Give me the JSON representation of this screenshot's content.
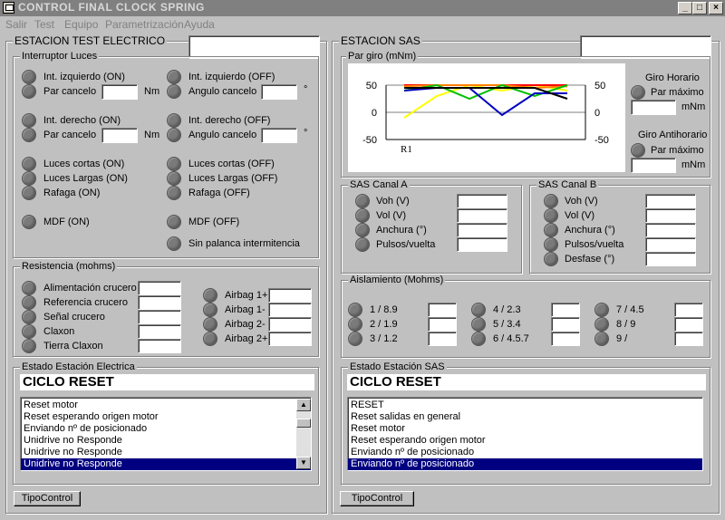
{
  "window": {
    "title": "CONTROL FINAL CLOCK SPRING",
    "min": "_",
    "max": "□",
    "close": "×"
  },
  "menu": [
    "Salir",
    "Test",
    "Equipo",
    "Parametrización",
    "Ayuda"
  ],
  "left": {
    "title": "ESTACION TEST ELECTRICO",
    "interruptor": {
      "title": "Interruptor Luces",
      "izq_on": "Int. izquierdo (ON)",
      "izq_off": "Int. izquierdo (OFF)",
      "par1": "Par cancelo",
      "ang1": "Angulo cancelo",
      "nm": "Nm",
      "deg": "°",
      "der_on": "Int. derecho (ON)",
      "der_off": "Int. derecho (OFF)",
      "par2": "Par cancelo",
      "ang2": "Angulo cancelo",
      "cortas_on": "Luces cortas (ON)",
      "cortas_off": "Luces cortas (OFF)",
      "largas_on": "Luces Largas (ON)",
      "largas_off": "Luces Largas (OFF)",
      "rafaga_on": "Rafaga (ON)",
      "rafaga_off": "Rafaga (OFF)",
      "mdf_on": "MDF (ON)",
      "mdf_off": "MDF (OFF)",
      "sin_palanca": "Sin palanca intermitencia"
    },
    "resistencia": {
      "title": "Resistencia (mohms)",
      "items": [
        "Alimentación crucero",
        "Referencia crucero",
        "Señal crucero",
        "Claxon",
        "Tierra Claxon"
      ],
      "airbags": [
        "Airbag 1+",
        "Airbag 1-",
        "Airbag 2-",
        "Airbag 2+"
      ]
    },
    "estado": {
      "title": "Estado Estación Electrica",
      "status": "CICLO RESET",
      "log": [
        "Reset motor",
        "Reset esperando origen motor",
        "Enviando nº de posicionado",
        "Unidrive no Responde",
        "Unidrive no Responde",
        "Unidrive no Responde"
      ],
      "selected": 5
    },
    "tipo_button": "TipoControl"
  },
  "right": {
    "title": "ESTACION SAS",
    "par_giro": {
      "title": "Par giro (mNm)",
      "horario": "Giro Horario",
      "antihorario": "Giro Antihorario",
      "par_max": "Par máximo",
      "unit": "mNm"
    },
    "chart_data": {
      "type": "line",
      "title": "Par giro (mNm)",
      "ylim": [
        -50,
        50
      ],
      "yticks_left": [
        "50",
        "0",
        "-50"
      ],
      "yticks_right": [
        "50",
        "0",
        "-50"
      ],
      "xlabel": "R1",
      "x": [
        0,
        1,
        2,
        3,
        4,
        5
      ],
      "series": [
        {
          "color": "#ffff00",
          "values": [
            -10,
            30,
            50,
            40,
            50,
            40
          ]
        },
        {
          "color": "#ff0000",
          "values": [
            50,
            50,
            50,
            50,
            50,
            50
          ]
        },
        {
          "color": "#ff8000",
          "values": [
            48,
            50,
            50,
            50,
            45,
            48
          ]
        },
        {
          "color": "#00c000",
          "values": [
            40,
            50,
            25,
            50,
            30,
            50
          ]
        },
        {
          "color": "#0000c0",
          "values": [
            40,
            45,
            45,
            -5,
            35,
            35
          ]
        },
        {
          "color": "#000000",
          "values": [
            45,
            45,
            45,
            45,
            45,
            25
          ]
        }
      ]
    },
    "canal_a": {
      "title": "SAS Canal A",
      "items": [
        "Voh (V)",
        "Vol (V)",
        "Anchura (°)",
        "Pulsos/vuelta"
      ]
    },
    "canal_b": {
      "title": "SAS Canal B",
      "items": [
        "Voh (V)",
        "Vol (V)",
        "Anchura (°)",
        "Pulsos/vuelta",
        "Desfase (°)"
      ]
    },
    "aislamiento": {
      "title": "Aislamiento (Mohms)",
      "col1": [
        "1 / 8.9",
        "2 / 1.9",
        "3 / 1.2"
      ],
      "col2": [
        "4 / 2.3",
        "5 / 3.4",
        "6 / 4.5.7"
      ],
      "col3": [
        "7 / 4.5",
        "8 / 9",
        "9 /"
      ]
    },
    "estado": {
      "title": "Estado Estación SAS",
      "status": "CICLO RESET",
      "log": [
        "RESET",
        "Reset salidas en general",
        "Reset motor",
        "Reset esperando origen motor",
        "Enviando nº de posicionado",
        "Enviando nº de posicionado"
      ],
      "selected": 5
    },
    "tipo_button": "TipoControl"
  },
  "colors": {
    "titlebar": "#808080",
    "selection": "#000080",
    "face": "#c0c0c0"
  }
}
